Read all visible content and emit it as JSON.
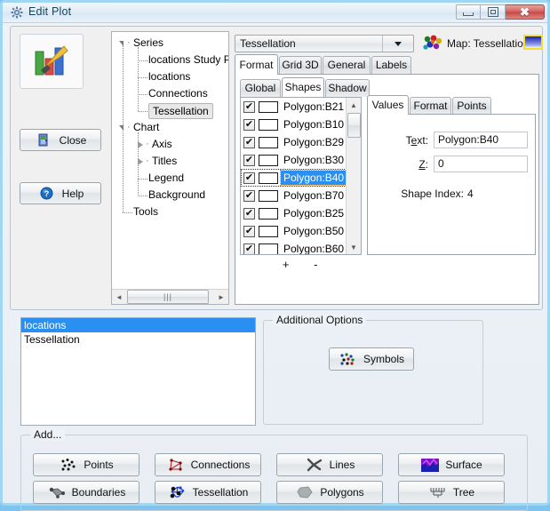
{
  "window": {
    "title": "Edit Plot",
    "icon": "plot-gear-icon",
    "controls": {
      "minimize": "–",
      "maximize": "□",
      "close": "✕"
    }
  },
  "left": {
    "plot_icon": "chart-paintbrush-icon",
    "close_label": "Close",
    "close_icon": "exit-door-icon",
    "help_label": "Help",
    "help_icon": "question-mark-icon"
  },
  "tree": {
    "nodes": [
      {
        "label": "Series",
        "level": 0,
        "expander": "open",
        "selected": false
      },
      {
        "label": "locations Study P",
        "level": 1,
        "expander": "none",
        "selected": false
      },
      {
        "label": "locations",
        "level": 1,
        "expander": "none",
        "selected": false
      },
      {
        "label": "Connections",
        "level": 1,
        "expander": "none",
        "selected": false
      },
      {
        "label": "Tessellation",
        "level": 1,
        "expander": "none",
        "selected": true
      },
      {
        "label": "Chart",
        "level": 0,
        "expander": "open",
        "selected": false
      },
      {
        "label": "Axis",
        "level": 1,
        "expander": "closed",
        "selected": false
      },
      {
        "label": "Titles",
        "level": 1,
        "expander": "closed",
        "selected": false
      },
      {
        "label": "Legend",
        "level": 1,
        "expander": "none",
        "selected": false
      },
      {
        "label": "Background",
        "level": 1,
        "expander": "none",
        "selected": false
      },
      {
        "label": "Tools",
        "level": 0,
        "expander": "none",
        "selected": false
      }
    ],
    "scroll_left_arrow": "◄",
    "scroll_right_arrow": "►",
    "scroll_thumb_grip": "|||"
  },
  "format_panel": {
    "combo_value": "Tessellation",
    "map_icon": "map-shapes-icon",
    "map_label": "Map: Tessellation",
    "map_swatch_color": "#1b1fb0",
    "tabs": [
      {
        "label": "Format",
        "active": true
      },
      {
        "label": "Grid 3D",
        "active": false
      },
      {
        "label": "General",
        "active": false
      },
      {
        "label": "Labels",
        "active": false
      }
    ],
    "subtabs": [
      {
        "label": "Global",
        "active": false
      },
      {
        "label": "Shapes",
        "active": true
      },
      {
        "label": "Shadow",
        "active": false
      }
    ],
    "shapes": [
      {
        "label": "Polygon:B21",
        "checked": true,
        "color": "#ffffff",
        "selected": false
      },
      {
        "label": "Polygon:B10",
        "checked": true,
        "color": "#ffffff",
        "selected": false
      },
      {
        "label": "Polygon:B29",
        "checked": true,
        "color": "#ffffff",
        "selected": false
      },
      {
        "label": "Polygon:B30",
        "checked": true,
        "color": "#ffffff",
        "selected": false
      },
      {
        "label": "Polygon:B40",
        "checked": true,
        "color": "#ffffff",
        "selected": true
      },
      {
        "label": "Polygon:B70",
        "checked": true,
        "color": "#ffffff",
        "selected": false
      },
      {
        "label": "Polygon:B25",
        "checked": true,
        "color": "#ffffff",
        "selected": false
      },
      {
        "label": "Polygon:B50",
        "checked": true,
        "color": "#ffffff",
        "selected": false
      },
      {
        "label": "Polygon:B60",
        "checked": true,
        "color": "#ffffff",
        "selected": false
      }
    ],
    "check_glyph": "✔",
    "add_shape_label": "+",
    "remove_shape_label": "-",
    "scroll_up_arrow": "▲",
    "scroll_down_arrow": "▼",
    "value_tabs": [
      {
        "label": "Values",
        "active": true
      },
      {
        "label": "Format",
        "active": false
      },
      {
        "label": "Points",
        "active": false
      }
    ],
    "values": {
      "text_label": "Text:",
      "text_value": "Polygon:B40",
      "z_label": "Z:",
      "z_value": "0",
      "shape_index_label": "Shape Index:",
      "shape_index_value": "4"
    }
  },
  "series_list": {
    "items": [
      {
        "label": "locations",
        "selected": true
      },
      {
        "label": "Tessellation",
        "selected": false
      }
    ]
  },
  "additional_options": {
    "title": "Additional Options",
    "symbols_label": "Symbols",
    "symbols_icon": "scatter-dots-icon"
  },
  "add_group": {
    "title": "Add...",
    "buttons": [
      {
        "label": "Points",
        "icon": "scatter-dots-icon"
      },
      {
        "label": "Connections",
        "icon": "connections-graph-icon"
      },
      {
        "label": "Lines",
        "icon": "lines-icon"
      },
      {
        "label": "Surface",
        "icon": "surface-icon"
      },
      {
        "label": "Boundaries",
        "icon": "boundaries-icon"
      },
      {
        "label": "Tessellation",
        "icon": "tessellation-icon"
      },
      {
        "label": "Polygons",
        "icon": "polygon-blob-icon"
      },
      {
        "label": "Tree",
        "icon": "tree-icon"
      }
    ]
  }
}
